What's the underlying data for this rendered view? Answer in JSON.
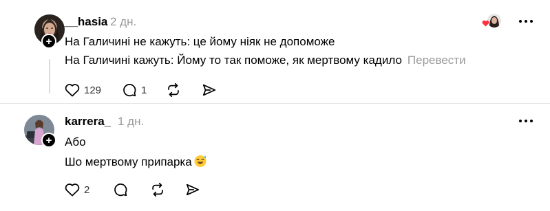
{
  "posts": [
    {
      "username": "__hasia",
      "time": "2 дн.",
      "lines": [
        "На Галичині не кажуть: це йому ніяк не допоможе",
        "На Галичині кажуть: Йому то так поможе, як мертвому кадило"
      ],
      "translate": "Перевести",
      "likes": "129",
      "replies": "1",
      "reposts": "",
      "shares": ""
    },
    {
      "username": "karrera_",
      "time": "1 дн.",
      "lines": [
        "Або",
        "Шо мертвому припарка"
      ],
      "likes": "2",
      "replies": "",
      "reposts": "",
      "shares": ""
    }
  ],
  "colors": {
    "text": "#000000",
    "muted": "#999999",
    "divider": "#e5e5e5",
    "heart": "#ff3040"
  },
  "icons": [
    "heart-icon",
    "comment-icon",
    "repost-icon",
    "share-icon",
    "more-icon",
    "plus-icon"
  ]
}
